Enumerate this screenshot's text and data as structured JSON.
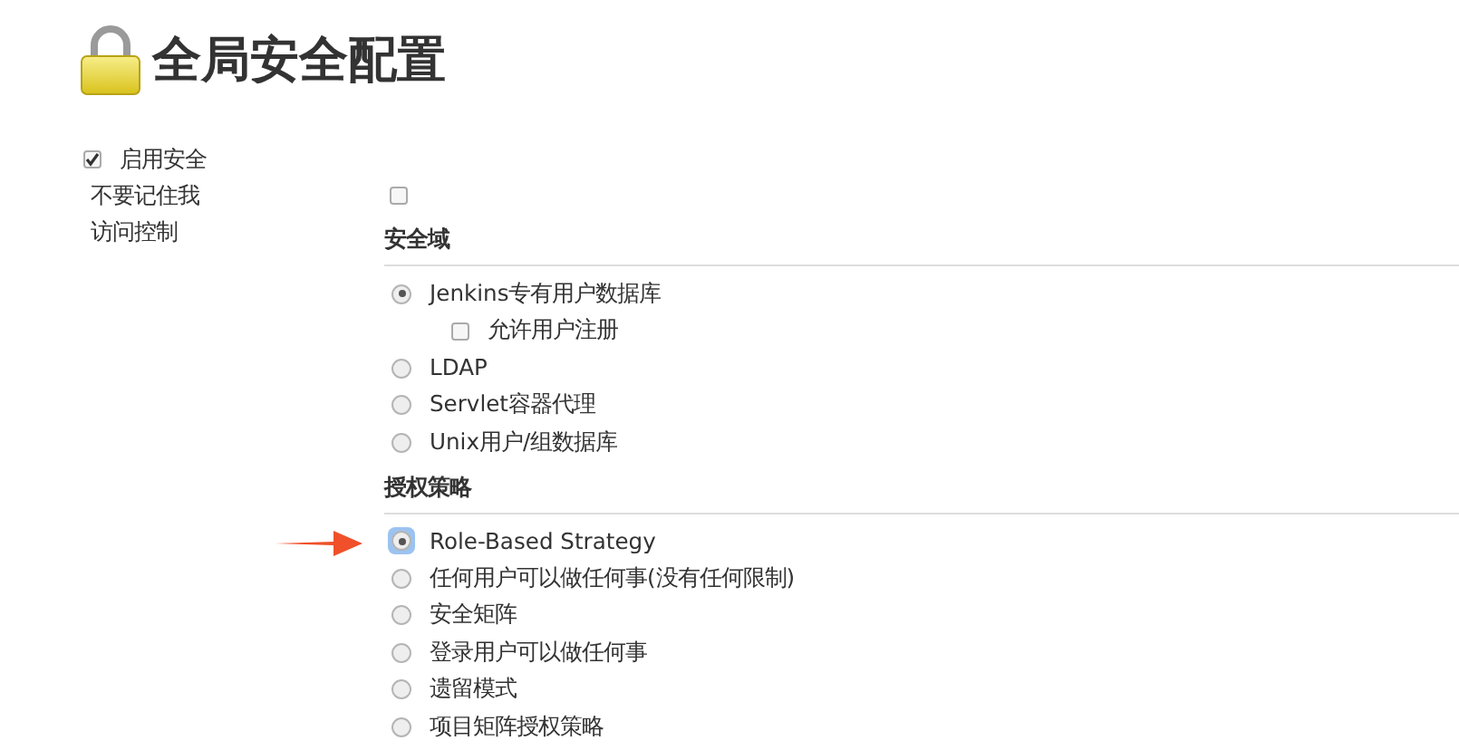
{
  "title": "全局安全配置",
  "enable_security": {
    "label": "启用安全",
    "checked": true
  },
  "remember_me": {
    "label": "不要记住我",
    "checked": false
  },
  "access_control": {
    "label": "访问控制",
    "sections": [
      {
        "heading": "安全域",
        "options": [
          {
            "label": "Jenkins专有用户数据库",
            "selected": true,
            "focused": false,
            "annotated": false,
            "children": [
              {
                "label": "允许用户注册",
                "checked": false
              }
            ]
          },
          {
            "label": "LDAP",
            "selected": false,
            "focused": false,
            "annotated": false
          },
          {
            "label": "Servlet容器代理",
            "selected": false,
            "focused": false,
            "annotated": false
          },
          {
            "label": "Unix用户/组数据库",
            "selected": false,
            "focused": false,
            "annotated": false
          }
        ]
      },
      {
        "heading": "授权策略",
        "options": [
          {
            "label": "Role-Based Strategy",
            "selected": true,
            "focused": true,
            "annotated": true
          },
          {
            "label": "任何用户可以做任何事(没有任何限制)",
            "selected": false,
            "focused": false,
            "annotated": false
          },
          {
            "label": "安全矩阵",
            "selected": false,
            "focused": false,
            "annotated": false
          },
          {
            "label": "登录用户可以做任何事",
            "selected": false,
            "focused": false,
            "annotated": false
          },
          {
            "label": "遗留模式",
            "selected": false,
            "focused": false,
            "annotated": false
          },
          {
            "label": "项目矩阵授权策略",
            "selected": false,
            "focused": false,
            "annotated": false
          }
        ]
      }
    ]
  }
}
